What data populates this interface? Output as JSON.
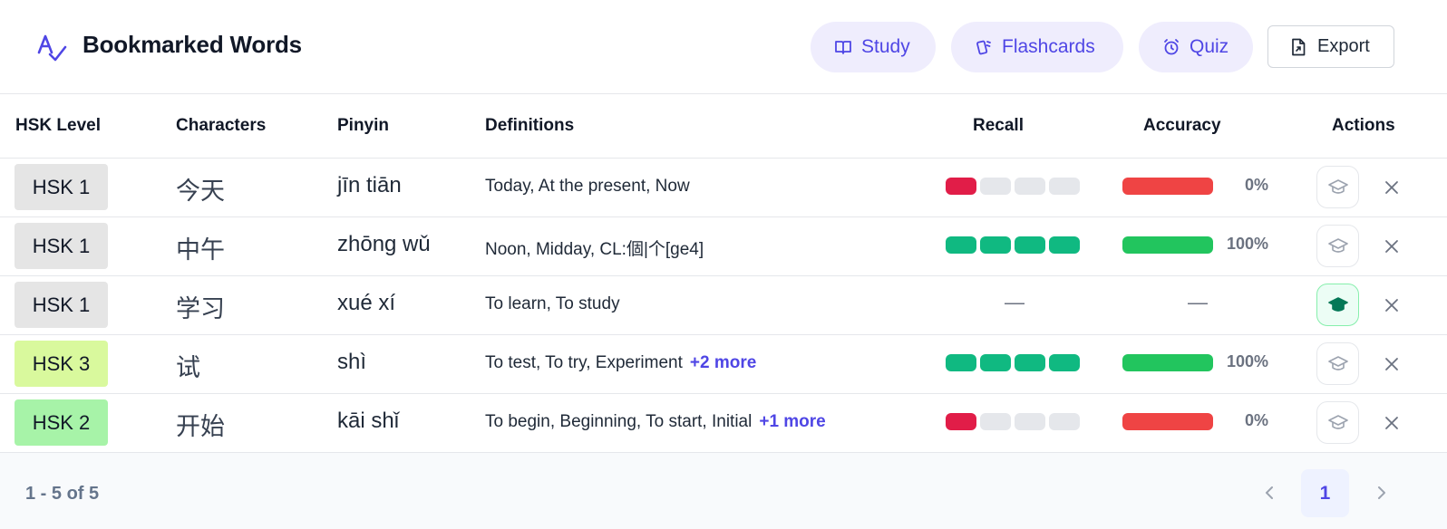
{
  "header": {
    "title": "Bookmarked Words",
    "study_label": "Study",
    "flashcards_label": "Flashcards",
    "quiz_label": "Quiz",
    "export_label": "Export"
  },
  "columns": {
    "hsk": "HSK Level",
    "characters": "Characters",
    "pinyin": "Pinyin",
    "definitions": "Definitions",
    "recall": "Recall",
    "accuracy": "Accuracy",
    "actions": "Actions"
  },
  "rows": [
    {
      "hsk": "HSK 1",
      "hsk_color": "#e5e5e5",
      "characters": "今天",
      "pinyin": "jīn tiān",
      "definitions": "Today, At the present, Now",
      "more": "",
      "recall_filled": 1,
      "recall_total": 4,
      "recall_text": "",
      "accuracy": 0,
      "accuracy_text": "0%",
      "studied": false
    },
    {
      "hsk": "HSK 1",
      "hsk_color": "#e5e5e5",
      "characters": "中午",
      "pinyin": "zhōng wǔ",
      "definitions": "Noon, Midday, CL:個|个[ge4]",
      "more": "",
      "recall_filled": 4,
      "recall_total": 4,
      "recall_text": "",
      "accuracy": 100,
      "accuracy_text": "100%",
      "studied": false
    },
    {
      "hsk": "HSK 1",
      "hsk_color": "#e5e5e5",
      "characters": "学习",
      "pinyin": "xué xí",
      "definitions": "To learn, To study",
      "more": "",
      "recall_filled": null,
      "recall_total": 4,
      "recall_text": "—",
      "accuracy": null,
      "accuracy_text": "—",
      "studied": true
    },
    {
      "hsk": "HSK 3",
      "hsk_color": "#d9f99d",
      "characters": "试",
      "pinyin": "shì",
      "definitions": "To test, To try, Experiment",
      "more": "+2 more",
      "recall_filled": 4,
      "recall_total": 4,
      "recall_text": "",
      "accuracy": 100,
      "accuracy_text": "100%",
      "studied": false
    },
    {
      "hsk": "HSK 2",
      "hsk_color": "#a7f3a8",
      "characters": "开始",
      "pinyin": "kāi shǐ",
      "definitions": "To begin, Beginning, To start, Initial",
      "more": "+1 more",
      "recall_filled": 1,
      "recall_total": 4,
      "recall_text": "",
      "accuracy": 0,
      "accuracy_text": "0%",
      "studied": false
    }
  ],
  "footer": {
    "range": "1 - 5 of 5",
    "current_page": "1"
  },
  "colors": {
    "accent": "#4f46e5",
    "recall_low": "#e11d48",
    "recall_high": "#10b981",
    "recall_empty": "#e5e7eb",
    "accuracy_low": "#ef4444",
    "accuracy_high": "#22c55e"
  },
  "icons": {
    "logo": "translate-check-icon",
    "study": "book-open-icon",
    "flashcards": "cards-icon",
    "quiz": "alarm-clock-icon",
    "export": "file-export-icon",
    "row_study": "graduation-cap-icon",
    "row_remove": "close-icon",
    "prev": "chevron-left-icon",
    "next": "chevron-right-icon"
  }
}
